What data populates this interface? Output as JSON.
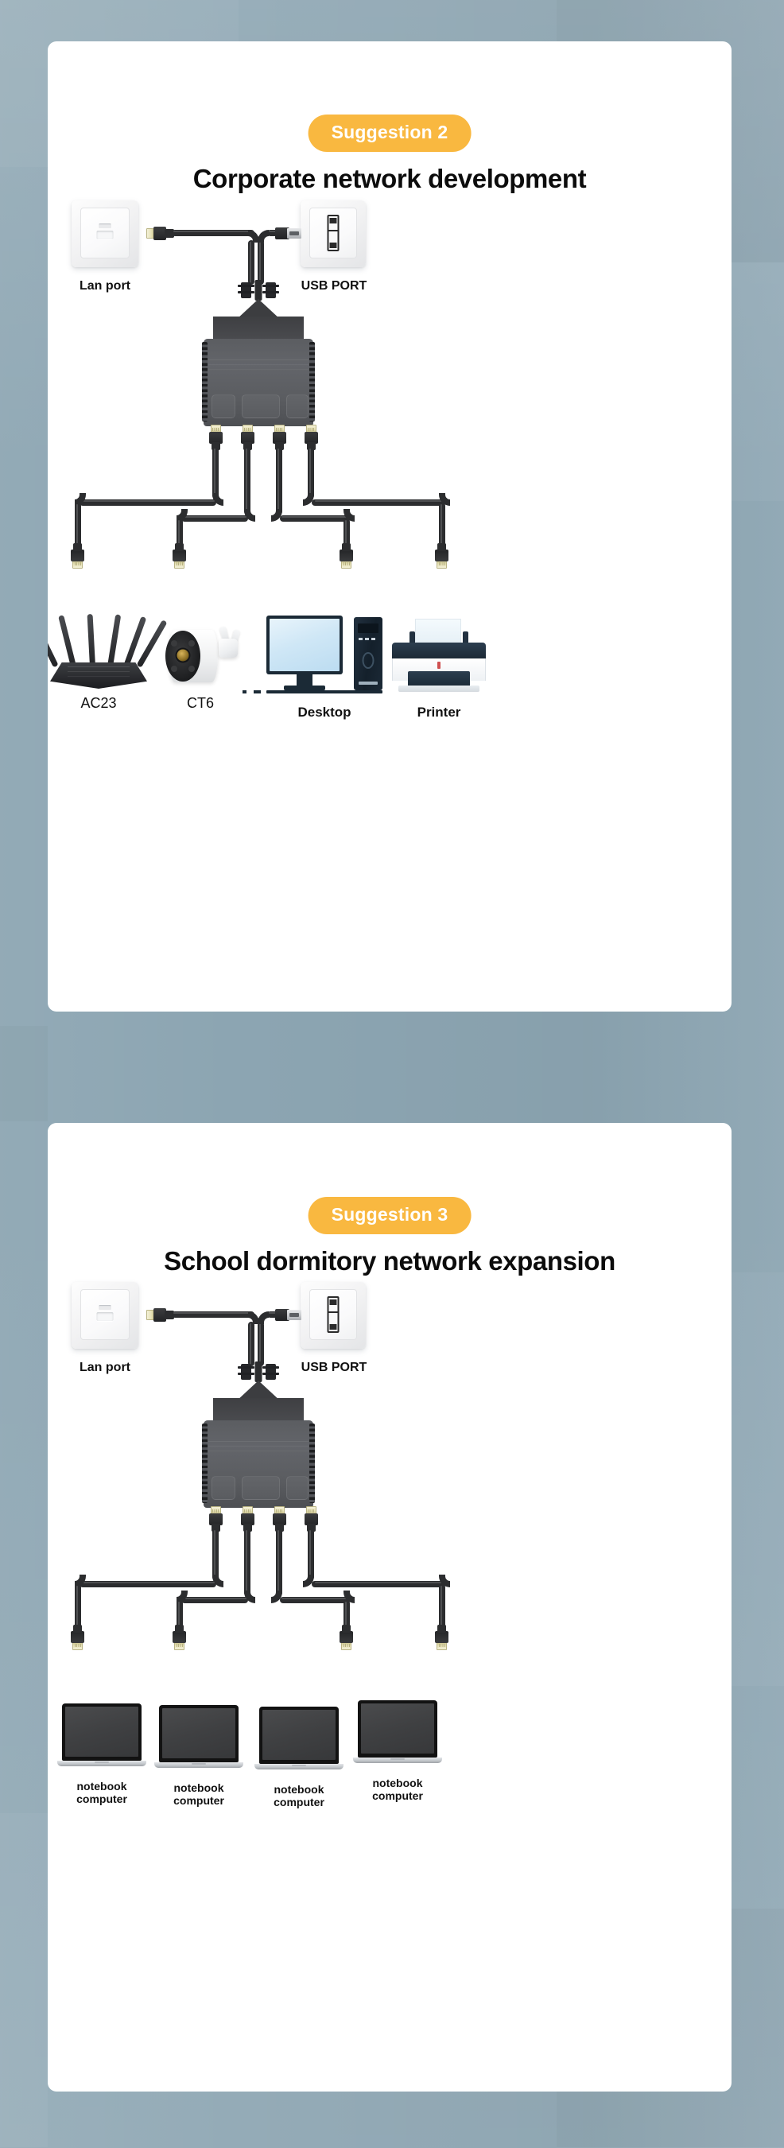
{
  "theme": {
    "page_background": "#8ca5b2",
    "card_background": "#ffffff",
    "badge_color": "#f9b840",
    "badge_text_color": "#ffffff",
    "heading_color": "#0c0c0c",
    "cable_color": "#2c2d2f",
    "splitter_color": "#5b5d61"
  },
  "cards": [
    {
      "badge": "Suggestion 2",
      "headline": "Corporate network development",
      "sources": [
        {
          "caption": "Lan port",
          "icon": "lan-wall-plate-icon"
        },
        {
          "caption": "USB PORT",
          "icon": "usb-wall-plate-icon"
        }
      ],
      "devices": [
        {
          "caption": "AC23",
          "icon": "wifi-router-icon",
          "caption_style": "light"
        },
        {
          "caption": "CT6",
          "icon": "security-camera-icon",
          "caption_style": "light"
        },
        {
          "caption": "Desktop",
          "icon": "desktop-computer-icon",
          "caption_style": "bold"
        },
        {
          "caption": "Printer",
          "icon": "printer-icon",
          "caption_style": "bold"
        }
      ]
    },
    {
      "badge": "Suggestion 3",
      "headline": "School dormitory network expansion",
      "sources": [
        {
          "caption": "Lan port",
          "icon": "lan-wall-plate-icon"
        },
        {
          "caption": "USB PORT",
          "icon": "usb-wall-plate-icon"
        }
      ],
      "devices": [
        {
          "caption": "notebook\ncomputer",
          "icon": "laptop-icon",
          "caption_style": "small"
        },
        {
          "caption": "notebook\ncomputer",
          "icon": "laptop-icon",
          "caption_style": "small"
        },
        {
          "caption": "notebook\ncomputer",
          "icon": "laptop-icon",
          "caption_style": "small"
        },
        {
          "caption": "notebook\ncomputer",
          "icon": "laptop-icon",
          "caption_style": "small"
        }
      ]
    }
  ]
}
